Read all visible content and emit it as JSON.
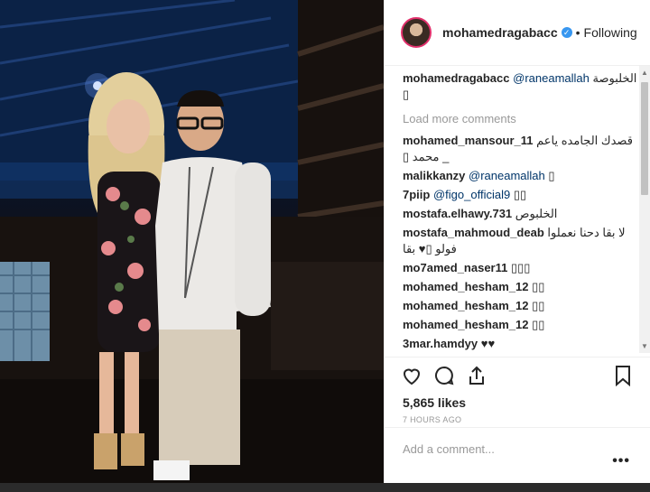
{
  "post": {
    "username": "mohamedragabacc",
    "follow_status": "Following",
    "dot": "•",
    "verified_glyph": "✓"
  },
  "caption": {
    "user": "mohamedragabacc",
    "mention": "@raneamallah",
    "text": "الخلبوصة",
    "emoji": "▯"
  },
  "load_more": "Load more comments",
  "comments": [
    {
      "user": "mohamed_mansour_11",
      "text": "قصدك الجامده ياعم _ محمد ▯"
    },
    {
      "user": "malikkanzy",
      "mention": "@raneamallah",
      "text": "▯"
    },
    {
      "user": "7piip",
      "mention": "@figo_official9",
      "text": "▯▯"
    },
    {
      "user": "mostafa.elhawy.731",
      "text": "الخلبوص"
    },
    {
      "user": "mostafa_mahmoud_deab",
      "text": "لا بقا دحنا نعملوا فولو ▯♥ بقا"
    },
    {
      "user": "mo7amed_naser11",
      "text": "▯▯▯"
    },
    {
      "user": "mohamed_hesham_12",
      "text": "▯▯"
    },
    {
      "user": "mohamed_hesham_12",
      "text": "▯▯"
    },
    {
      "user": "mohamed_hesham_12",
      "text": "▯▯"
    },
    {
      "user": "3mar.hamdyy",
      "text": "♥♥"
    }
  ],
  "likes": "5,865 likes",
  "timestamp": "7 HOURS AGO",
  "add_comment_placeholder": "Add a comment...",
  "more_options": "•••",
  "scroll_up": "▲",
  "scroll_down": "▼",
  "icons": {
    "like": "heart-icon",
    "comment": "comment-icon",
    "share": "share-icon",
    "save": "bookmark-icon"
  },
  "colors": {
    "username": "#262626",
    "mention": "#003569",
    "muted": "#999999",
    "verified": "#3897f0"
  }
}
